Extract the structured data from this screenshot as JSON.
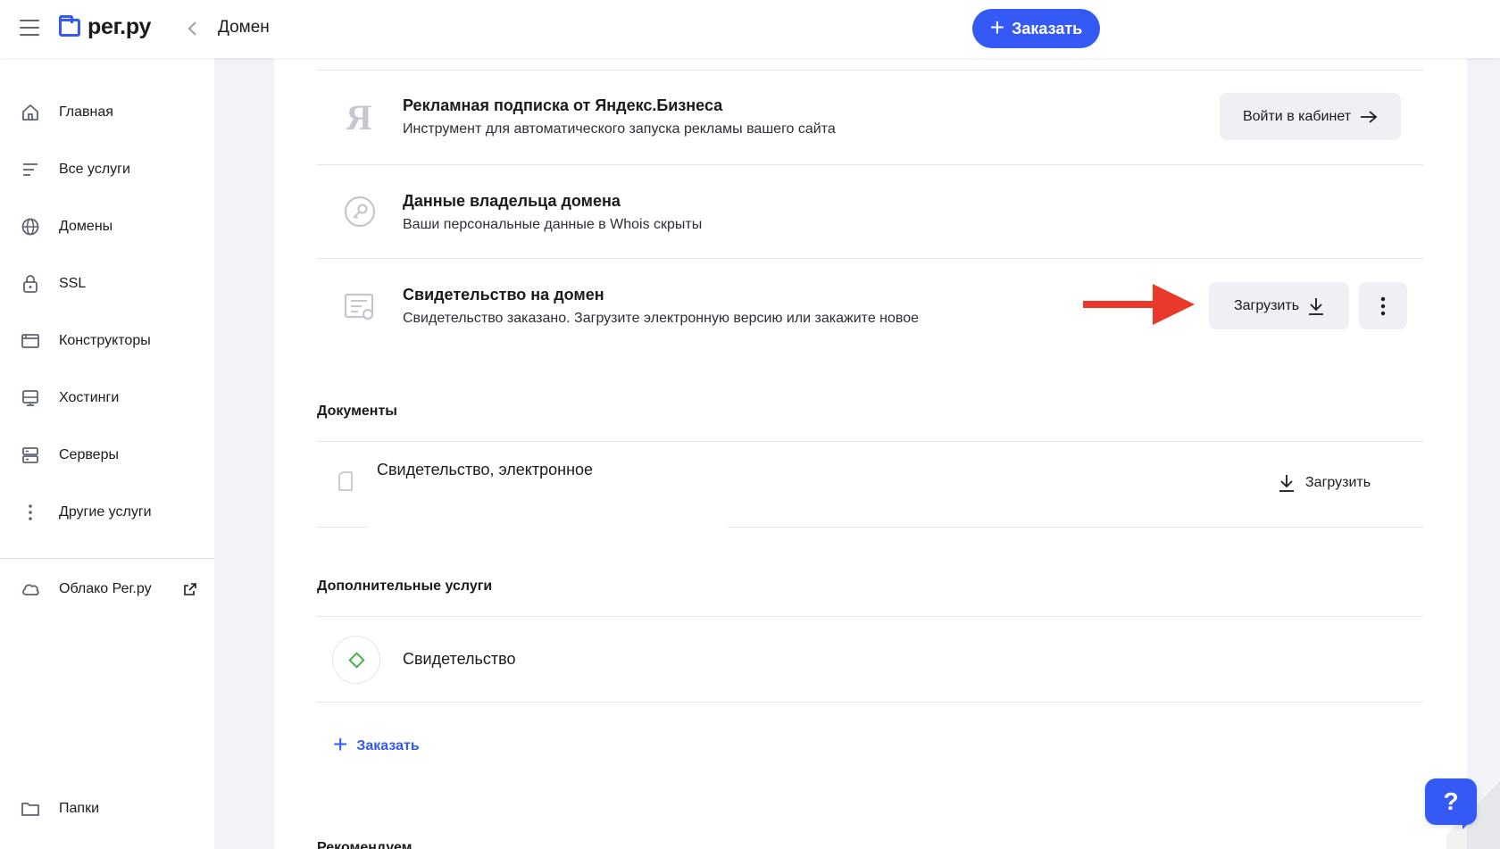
{
  "header": {
    "logo_text": "рег.ру",
    "page_title": "Домен",
    "order_label": "Заказать"
  },
  "sidebar": {
    "items": [
      {
        "label": "Главная",
        "icon": "home-icon"
      },
      {
        "label": "Все услуги",
        "icon": "list-icon"
      },
      {
        "label": "Домены",
        "icon": "globe-icon"
      },
      {
        "label": "SSL",
        "icon": "lock-icon"
      },
      {
        "label": "Конструкторы",
        "icon": "browser-window-icon"
      },
      {
        "label": "Хостинги",
        "icon": "hosting-icon"
      },
      {
        "label": "Серверы",
        "icon": "server-icon"
      },
      {
        "label": "Другие услуги",
        "icon": "more-vertical-icon"
      }
    ],
    "cloud": {
      "label": "Облако Рег.ру",
      "icon": "cloud-icon"
    },
    "folders": {
      "label": "Папки",
      "icon": "folder-icon"
    }
  },
  "services": {
    "yandex": {
      "title": "Рекламная подписка от Яндекс.Бизнеса",
      "desc": "Инструмент для автоматического запуска рекламы вашего сайта",
      "button": "Войти в кабинет"
    },
    "whois": {
      "title": "Данные владельца домена",
      "desc": "Ваши персональные данные в Whois скрыты"
    },
    "certificate": {
      "title": "Свидетельство на домен",
      "desc": "Свидетельство заказано. Загрузите электронную версию или закажите новое",
      "button": "Загрузить"
    }
  },
  "documents": {
    "section_title": "Документы",
    "items": [
      {
        "name": "Свидетельство, электронное",
        "action": "Загрузить"
      }
    ]
  },
  "extra": {
    "section_title": "Дополнительные услуги",
    "items": [
      {
        "name": "Свидетельство"
      }
    ],
    "order_label": "Заказать"
  },
  "recommend": {
    "section_title": "Рекомендуем"
  },
  "help": {
    "label": "?"
  },
  "colors": {
    "accent": "#3459f5",
    "arrow": "#e8392a",
    "diamond": "#4caf50"
  }
}
